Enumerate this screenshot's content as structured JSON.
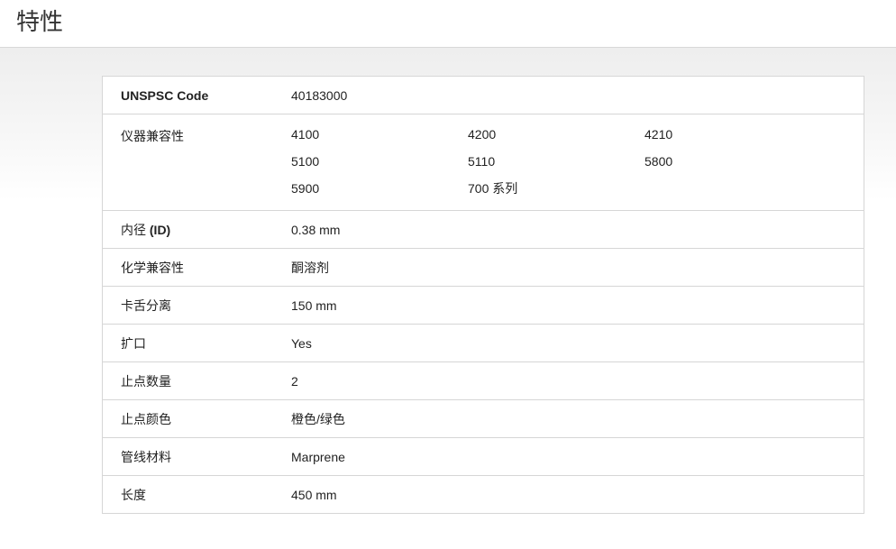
{
  "page": {
    "title": "特性"
  },
  "specs": {
    "unspsc": {
      "label": "UNSPSC Code",
      "value": "40183000"
    },
    "compat": {
      "label": "仪器兼容性",
      "values": [
        "4100",
        "4200",
        "4210",
        "5100",
        "5110",
        "5800",
        "5900",
        "700 系列"
      ]
    },
    "id": {
      "label_prefix": "内径 ",
      "label_bold": "(ID)",
      "value": "0.38 mm"
    },
    "chem": {
      "label": "化学兼容性",
      "value": "酮溶剂"
    },
    "bridge": {
      "label": "卡舌分离",
      "value": "150 mm"
    },
    "flared": {
      "label": "扩口",
      "value": "Yes"
    },
    "stops": {
      "label": "止点数量",
      "value": "2"
    },
    "stop_color": {
      "label": "止点颜色",
      "value": "橙色/绿色"
    },
    "tubing": {
      "label": "管线材料",
      "value": "Marprene"
    },
    "length": {
      "label": "长度",
      "value": "450 mm"
    }
  }
}
